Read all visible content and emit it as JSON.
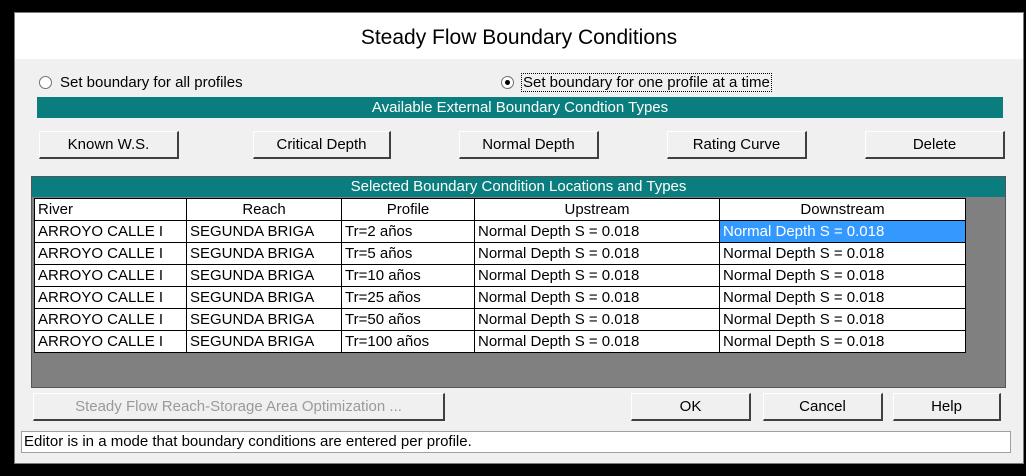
{
  "dialog": {
    "title": "Steady Flow Boundary Conditions"
  },
  "mode": {
    "all_profiles_label": "Set boundary for all profiles",
    "one_profile_label": "Set boundary for one profile at a time",
    "selected": "one_profile"
  },
  "types": {
    "header": "Available External Boundary Condtion Types",
    "buttons": [
      "Known W.S.",
      "Critical Depth",
      "Normal Depth",
      "Rating Curve",
      "Delete"
    ]
  },
  "locations": {
    "header": "Selected Boundary Condition Locations and Types",
    "columns": [
      "River",
      "Reach",
      "Profile",
      "Upstream",
      "Downstream"
    ],
    "rows": [
      [
        "ARROYO CALLE I",
        "SEGUNDA BRIGA",
        "Tr=2 años",
        "Normal Depth S = 0.018",
        "Normal Depth S = 0.018"
      ],
      [
        "ARROYO CALLE I",
        "SEGUNDA BRIGA",
        "Tr=5 años",
        "Normal Depth S = 0.018",
        "Normal Depth S = 0.018"
      ],
      [
        "ARROYO CALLE I",
        "SEGUNDA BRIGA",
        "Tr=10 años",
        "Normal Depth S = 0.018",
        "Normal Depth S = 0.018"
      ],
      [
        "ARROYO CALLE I",
        "SEGUNDA BRIGA",
        "Tr=25 años",
        "Normal Depth S = 0.018",
        "Normal Depth S = 0.018"
      ],
      [
        "ARROYO CALLE I",
        "SEGUNDA BRIGA",
        "Tr=50 años",
        "Normal Depth S = 0.018",
        "Normal Depth S = 0.018"
      ],
      [
        "ARROYO CALLE I",
        "SEGUNDA BRIGA",
        "Tr=100 años",
        "Normal Depth S = 0.018",
        "Normal Depth S = 0.018"
      ]
    ],
    "selected_cell": {
      "row": 0,
      "column": 4
    }
  },
  "footer": {
    "optimization_label": "Steady Flow Reach-Storage Area Optimization ...",
    "ok_label": "OK",
    "cancel_label": "Cancel",
    "help_label": "Help"
  },
  "status": {
    "text": "Editor is in a mode that boundary conditions are entered per profile."
  },
  "colors": {
    "band": "#0a7e7e",
    "selection": "#3399ff"
  }
}
